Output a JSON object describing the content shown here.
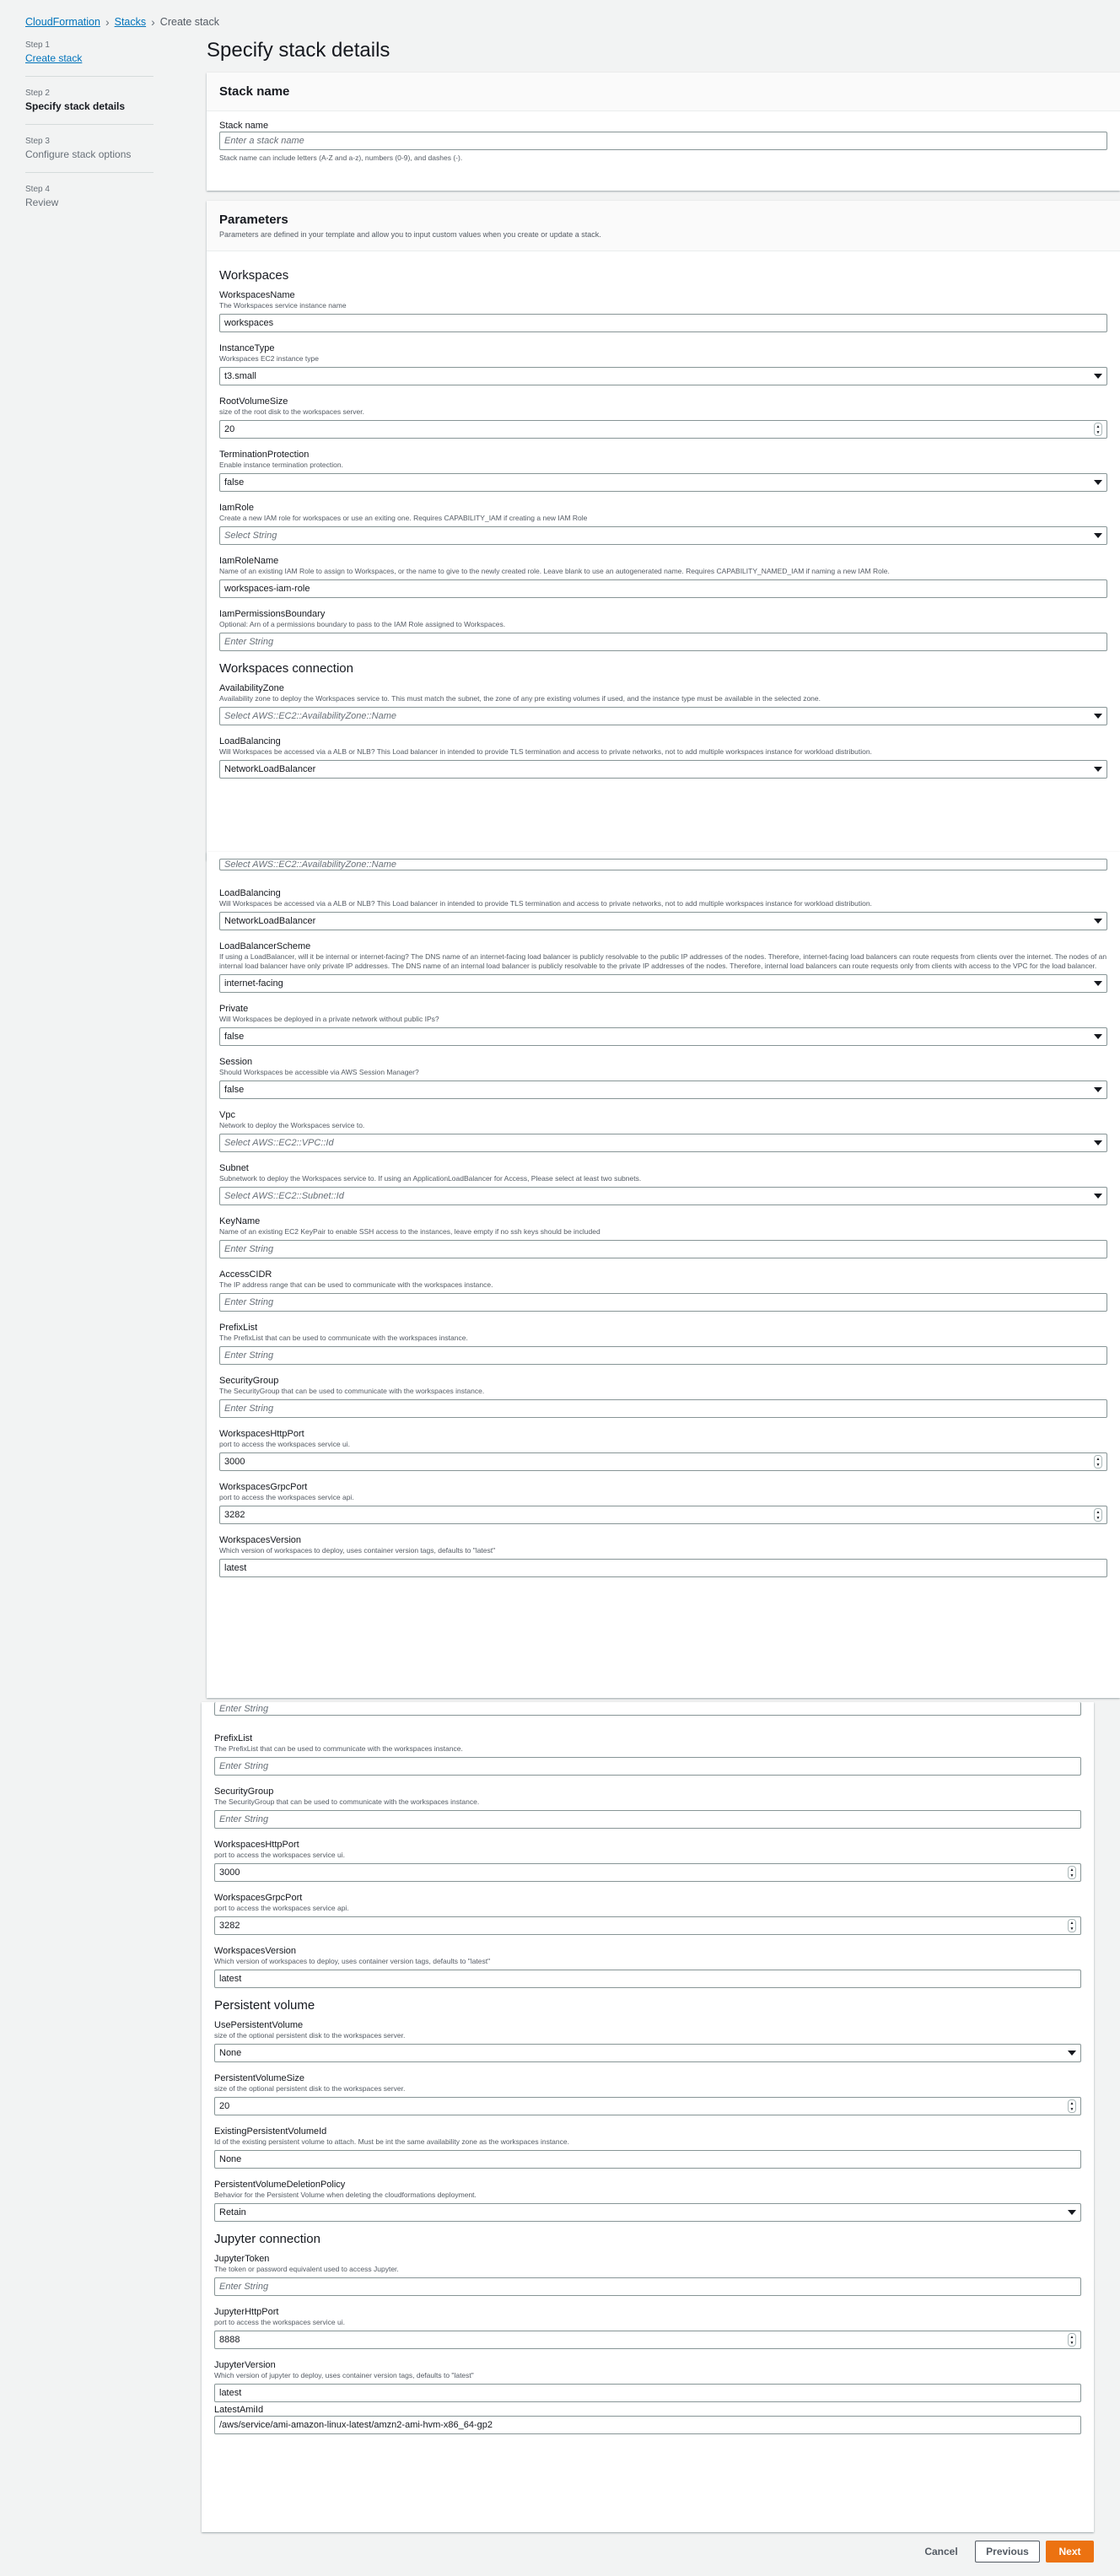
{
  "breadcrumb": {
    "root": "CloudFormation",
    "stacks": "Stacks",
    "current": "Create stack"
  },
  "steps": [
    {
      "num": "Step 1",
      "label": "Create stack"
    },
    {
      "num": "Step 2",
      "label": "Specify stack details"
    },
    {
      "num": "Step 3",
      "label": "Configure stack options"
    },
    {
      "num": "Step 4",
      "label": "Review"
    }
  ],
  "page_title": "Specify stack details",
  "stack_name": {
    "title": "Stack name",
    "label": "Stack name",
    "placeholder": "Enter a stack name",
    "help": "Stack name can include letters (A-Z and a-z), numbers (0-9), and dashes (-)."
  },
  "parameters": {
    "title": "Parameters",
    "desc": "Parameters are defined in your template and allow you to input custom values when you create or update a stack."
  },
  "sections": {
    "workspaces": "Workspaces",
    "workspaces_connection": "Workspaces connection",
    "persistent_volume": "Persistent volume",
    "jupyter_connection": "Jupyter connection"
  },
  "fields": {
    "WorkspacesName": {
      "label": "WorkspacesName",
      "desc": "The Workspaces service instance name",
      "value": "workspaces"
    },
    "InstanceType": {
      "label": "InstanceType",
      "desc": "Workspaces EC2 instance type",
      "value": "t3.small"
    },
    "RootVolumeSize": {
      "label": "RootVolumeSize",
      "desc": "size of the root disk to the workspaces server.",
      "value": "20"
    },
    "TerminationProtection": {
      "label": "TerminationProtection",
      "desc": "Enable instance termination protection.",
      "value": "false"
    },
    "IamRole": {
      "label": "IamRole",
      "desc": "Create a new IAM role for workspaces or use an exiting one. Requires CAPABILITY_IAM if creating a new IAM Role",
      "placeholder": "Select String"
    },
    "IamRoleName": {
      "label": "IamRoleName",
      "desc": "Name of an existing IAM Role to assign to Workspaces, or the name to give to the newly created role. Leave blank to use an autogenerated name. Requires CAPABILITY_NAMED_IAM if naming a new IAM Role.",
      "value": "workspaces-iam-role"
    },
    "IamPermissionsBoundary": {
      "label": "IamPermissionsBoundary",
      "desc": "Optional: Arn of a permissions boundary to pass to the IAM Role assigned to Workspaces.",
      "placeholder": "Enter String"
    },
    "AvailabilityZone": {
      "label": "AvailabilityZone",
      "desc": "Availability zone to deploy the Workspaces service to. This must match the subnet, the zone of any pre existing volumes if used, and the instance type must be available in the selected zone.",
      "placeholder": "Select AWS::EC2::AvailabilityZone::Name"
    },
    "LoadBalancing": {
      "label": "LoadBalancing",
      "desc": "Will Workspaces be accessed via a ALB or NLB? This Load balancer in intended to provide TLS termination and access to private networks, not to add multiple workspaces instance for workload distribution.",
      "value": "NetworkLoadBalancer"
    },
    "LoadBalancerScheme": {
      "label": "LoadBalancerScheme",
      "desc": "If using a LoadBalancer, will it be internal or internet-facing? The DNS name of an internet-facing load balancer is publicly resolvable to the public IP addresses of the nodes. Therefore, internet-facing load balancers can route requests from clients over the internet. The nodes of an internal load balancer have only private IP addresses. The DNS name of an internal load balancer is publicly resolvable to the private IP addresses of the nodes. Therefore, internal load balancers can route requests only from clients with access to the VPC for the load balancer.",
      "value": "internet-facing"
    },
    "Private": {
      "label": "Private",
      "desc": "Will Workspaces be deployed in a private network without public IPs?",
      "value": "false"
    },
    "Session": {
      "label": "Session",
      "desc": "Should Workspaces be accessible via AWS Session Manager?",
      "value": "false"
    },
    "Vpc": {
      "label": "Vpc",
      "desc": "Network to deploy the Workspaces service to.",
      "placeholder": "Select AWS::EC2::VPC::Id"
    },
    "Subnet": {
      "label": "Subnet",
      "desc": "Subnetwork to deploy the Workspaces service to. If using an ApplicationLoadBalancer for Access, Please select at least two subnets.",
      "placeholder": "Select AWS::EC2::Subnet::Id"
    },
    "KeyName": {
      "label": "KeyName",
      "desc": "Name of an existing EC2 KeyPair to enable SSH access to the instances, leave empty if no ssh keys should be included",
      "placeholder": "Enter String"
    },
    "AccessCIDR": {
      "label": "AccessCIDR",
      "desc": "The IP address range that can be used to communicate with the workspaces instance.",
      "placeholder": "Enter String"
    },
    "PrefixList": {
      "label": "PrefixList",
      "desc": "The PrefixList that can be used to communicate with the workspaces instance.",
      "placeholder": "Enter String"
    },
    "SecurityGroup": {
      "label": "SecurityGroup",
      "desc": "The SecurityGroup that can be used to communicate with the workspaces instance.",
      "placeholder": "Enter String"
    },
    "WorkspacesHttpPort": {
      "label": "WorkspacesHttpPort",
      "desc": "port to access the workspaces service ui.",
      "value": "3000"
    },
    "WorkspacesGrpcPort": {
      "label": "WorkspacesGrpcPort",
      "desc": "port to access the workspaces service api.",
      "value": "3282"
    },
    "WorkspacesVersion": {
      "label": "WorkspacesVersion",
      "desc": "Which version of workspaces to deploy, uses container version tags, defaults to \"latest\"",
      "value": "latest"
    },
    "UsePersistentVolume": {
      "label": "UsePersistentVolume",
      "desc": "size of the optional persistent disk to the workspaces server.",
      "value": "None"
    },
    "PersistentVolumeSize": {
      "label": "PersistentVolumeSize",
      "desc": "size of the optional persistent disk to the workspaces server.",
      "value": "20"
    },
    "ExistingPersistentVolumeId": {
      "label": "ExistingPersistentVolumeId",
      "desc": "Id of the existing persistent volume to attach. Must be int the same availability zone as the workspaces instance.",
      "value": "None"
    },
    "PersistentVolumeDeletionPolicy": {
      "label": "PersistentVolumeDeletionPolicy",
      "desc": "Behavior for the Persistent Volume when deleting the cloudformations deployment.",
      "value": "Retain"
    },
    "JupyterToken": {
      "label": "JupyterToken",
      "desc": "The token or password equivalent used to access Jupyter.",
      "placeholder": "Enter String"
    },
    "JupyterHttpPort": {
      "label": "JupyterHttpPort",
      "desc": "port to access the workspaces service ui.",
      "value": "8888"
    },
    "JupyterVersion": {
      "label": "JupyterVersion",
      "desc": "Which version of jupyter to deploy, uses container version tags, defaults to \"latest\"",
      "value": "latest"
    },
    "LatestAmiId": {
      "label": "LatestAmiId",
      "value": "/aws/service/ami-amazon-linux-latest/amzn2-ami-hvm-x86_64-gp2"
    }
  },
  "buttons": {
    "cancel": "Cancel",
    "previous": "Previous",
    "next": "Next"
  }
}
